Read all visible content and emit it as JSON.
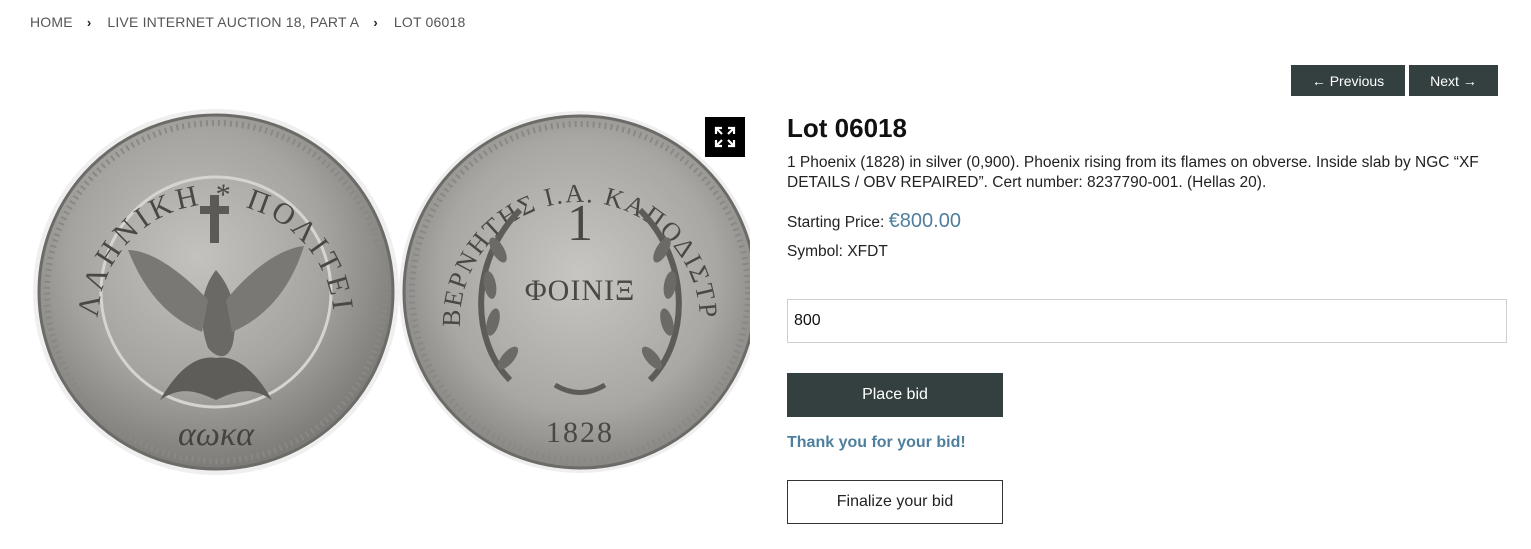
{
  "breadcrumb": {
    "items": [
      "HOME",
      "LIVE INTERNET AUCTION 18, PART A",
      "LOT 06018"
    ]
  },
  "nav": {
    "previous_label": "← Previous",
    "next_label": "Next →"
  },
  "lot": {
    "title": "Lot 06018",
    "description": "1 Phoenix (1828) in silver (0,900). Phoenix rising from its flames on obverse. Inside slab by NGC “XF DETAILS / OBV REPAIRED”. Cert number: 8237790-001. (Hellas 20).",
    "starting_price_label": "Starting Price:",
    "starting_price_value": "€800.00",
    "symbol_label": "Symbol:",
    "symbol_value": "XFDT"
  },
  "coin": {
    "obverse_legend": "ΕΛΛΗΝΙΚΗ * ΠΟΛΙΤΕΙΑ",
    "obverse_date": "αωκα",
    "reverse_legend": "ΚΥΒΕΡΝΗΤΗΣ Ι.Α. ΚΑΠΟΔΙΣΤΡΙΑΣ",
    "reverse_value": "1",
    "reverse_denom": "ΦΟΙΝΙΞ",
    "reverse_year": "1828"
  },
  "bid": {
    "input_value": "800",
    "place_label": "Place bid",
    "thanks_message": "Thank you for your bid!",
    "finalize_label": "Finalize your bid"
  },
  "colors": {
    "dark_button": "#344040",
    "accent_blue": "#4e7f9e",
    "coin_silver": "#a8a6a3"
  },
  "icons": {
    "expand": "expand-icon",
    "separator": "chevron-right-icon"
  }
}
